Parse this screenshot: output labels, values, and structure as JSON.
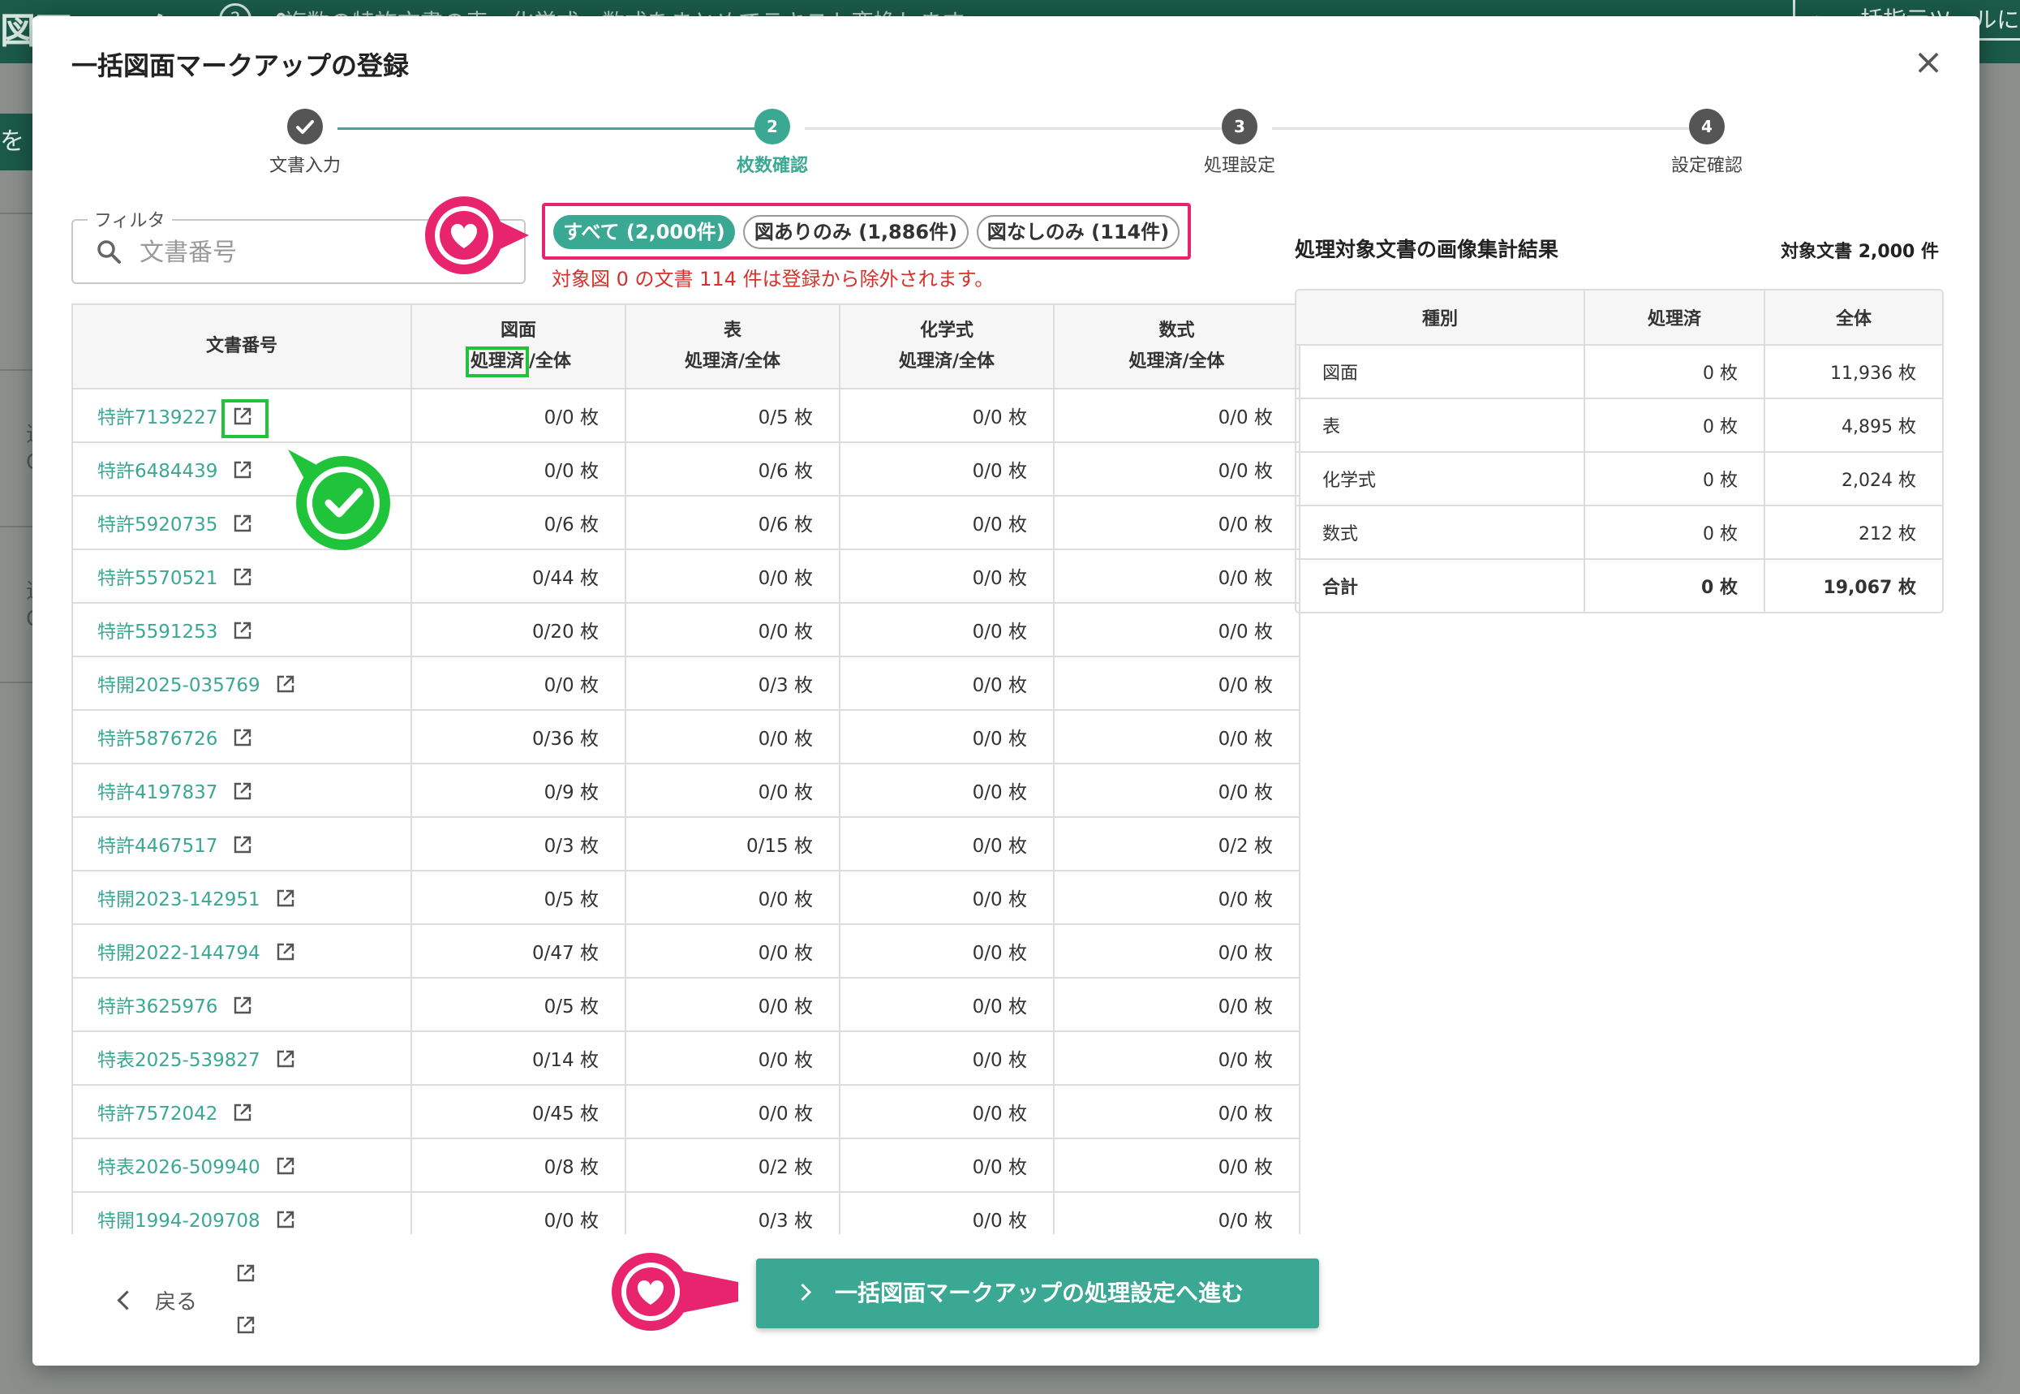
{
  "background": {
    "title": "図面マークアップ",
    "help_icon": "?",
    "description": "複数の特許文書の表・化学式・数式をまとめてテキスト変換します",
    "tool_button": "← 一括指示ツールに戻",
    "left_button": "を登",
    "frag1": "追",
    "frag2": "C",
    "frag3": "追",
    "frag4": "C"
  },
  "modal": {
    "title": "一括図面マークアップの登録",
    "close_icon": "×"
  },
  "steps": [
    {
      "number": "",
      "label": "文書入力",
      "state": "done"
    },
    {
      "number": "2",
      "label": "枚数確認",
      "state": "active"
    },
    {
      "number": "3",
      "label": "処理設定",
      "state": "pending"
    },
    {
      "number": "4",
      "label": "設定確認",
      "state": "pending"
    }
  ],
  "filter": {
    "legend": "フィルタ",
    "placeholder": "文書番号",
    "value": ""
  },
  "chips": [
    {
      "label": "すべて (2,000件)",
      "active": true
    },
    {
      "label": "図ありのみ (1,886件)",
      "active": false
    },
    {
      "label": "図なしのみ (114件)",
      "active": false
    }
  ],
  "warning": "対象図 0 の文書 114 件は登録から除外されます。",
  "table": {
    "col_doc": "文書番号",
    "col_figure": "図面",
    "col_table": "表",
    "col_chem": "化学式",
    "col_math": "数式",
    "sub_processed": "処理済",
    "sub_total": "/全体",
    "sub_full": "処理済/全体",
    "rows": [
      {
        "id": "特許7139227",
        "fig": "0/0 枚",
        "tbl": "0/5 枚",
        "chem": "0/0 枚",
        "math": "0/0 枚"
      },
      {
        "id": "特許6484439",
        "fig": "0/0 枚",
        "tbl": "0/6 枚",
        "chem": "0/0 枚",
        "math": "0/0 枚"
      },
      {
        "id": "特許5920735",
        "fig": "0/6 枚",
        "tbl": "0/6 枚",
        "chem": "0/0 枚",
        "math": "0/0 枚"
      },
      {
        "id": "特許5570521",
        "fig": "0/44 枚",
        "tbl": "0/0 枚",
        "chem": "0/0 枚",
        "math": "0/0 枚"
      },
      {
        "id": "特許5591253",
        "fig": "0/20 枚",
        "tbl": "0/0 枚",
        "chem": "0/0 枚",
        "math": "0/0 枚"
      },
      {
        "id": "特開2025-035769",
        "fig": "0/0 枚",
        "tbl": "0/3 枚",
        "chem": "0/0 枚",
        "math": "0/0 枚"
      },
      {
        "id": "特許5876726",
        "fig": "0/36 枚",
        "tbl": "0/0 枚",
        "chem": "0/0 枚",
        "math": "0/0 枚"
      },
      {
        "id": "特許4197837",
        "fig": "0/9 枚",
        "tbl": "0/0 枚",
        "chem": "0/0 枚",
        "math": "0/0 枚"
      },
      {
        "id": "特許4467517",
        "fig": "0/3 枚",
        "tbl": "0/15 枚",
        "chem": "0/0 枚",
        "math": "0/2 枚"
      },
      {
        "id": "特開2023-142951",
        "fig": "0/5 枚",
        "tbl": "0/0 枚",
        "chem": "0/0 枚",
        "math": "0/0 枚"
      },
      {
        "id": "特開2022-144794",
        "fig": "0/47 枚",
        "tbl": "0/0 枚",
        "chem": "0/0 枚",
        "math": "0/0 枚"
      },
      {
        "id": "特許3625976",
        "fig": "0/5 枚",
        "tbl": "0/0 枚",
        "chem": "0/0 枚",
        "math": "0/0 枚"
      },
      {
        "id": "特表2025-539827",
        "fig": "0/14 枚",
        "tbl": "0/0 枚",
        "chem": "0/0 枚",
        "math": "0/0 枚"
      },
      {
        "id": "特許7572042",
        "fig": "0/45 枚",
        "tbl": "0/0 枚",
        "chem": "0/0 枚",
        "math": "0/0 枚"
      },
      {
        "id": "特表2026-509940",
        "fig": "0/8 枚",
        "tbl": "0/2 枚",
        "chem": "0/0 枚",
        "math": "0/0 枚"
      },
      {
        "id": "特開1994-209708",
        "fig": "0/0 枚",
        "tbl": "0/3 枚",
        "chem": "0/0 枚",
        "math": "0/0 枚"
      }
    ]
  },
  "summary": {
    "title": "処理対象文書の画像集計結果",
    "count": "対象文書 2,000 件",
    "headers": [
      "種別",
      "処理済",
      "全体"
    ],
    "rows": [
      {
        "kind": "図面",
        "done": "0 枚",
        "total": "11,936 枚"
      },
      {
        "kind": "表",
        "done": "0 枚",
        "total": "4,895 枚"
      },
      {
        "kind": "化学式",
        "done": "0 枚",
        "total": "2,024 枚"
      },
      {
        "kind": "数式",
        "done": "0 枚",
        "total": "212 枚"
      },
      {
        "kind": "合計",
        "done": "0 枚",
        "total": "19,067 枚"
      }
    ]
  },
  "footer": {
    "back_label": "戻る",
    "next_label": "一括図面マークアップの処理設定へ進む"
  },
  "colors": {
    "accent": "#3aa892",
    "highlight_pink": "#e8246f",
    "highlight_green": "#1fc43a",
    "warning_red": "#d6322c"
  },
  "icons": {
    "marker": "heart-icon",
    "annotation": "check-icon",
    "row_link": "external-link-icon",
    "search": "search-icon"
  }
}
